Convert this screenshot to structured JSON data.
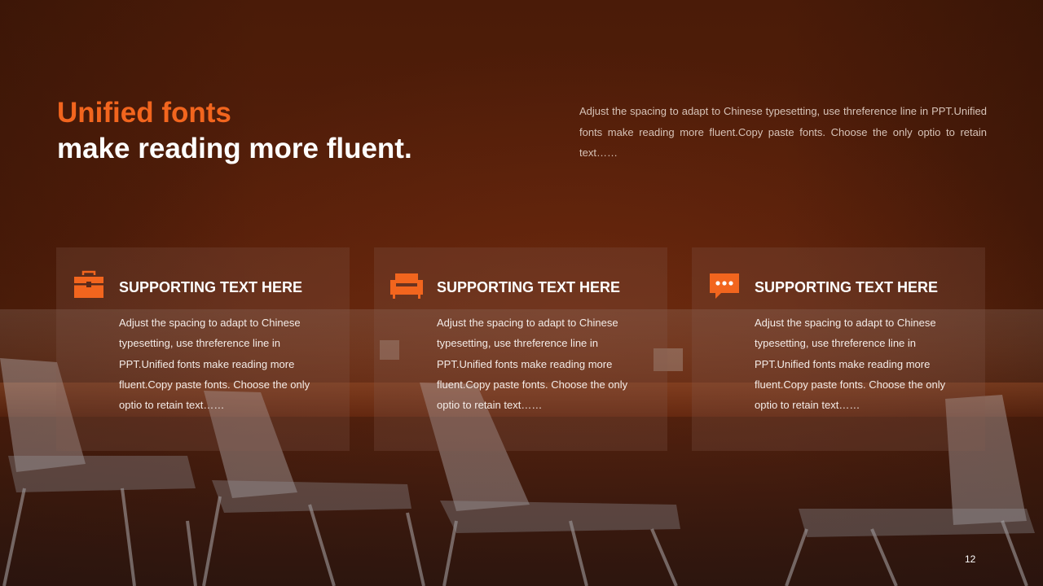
{
  "slide": {
    "title_accent": "Unified fonts",
    "title_main": "make reading more fluent.",
    "intro_text": "Adjust the spacing to adapt to Chinese typesetting, use threference line in PPT.Unified fonts make reading more fluent.Copy paste fonts. Choose the only optio to retain text……",
    "page_number": "12",
    "cards": [
      {
        "icon": "toolbox-icon",
        "title": "SUPPORTING TEXT HERE",
        "text": "Adjust the spacing to adapt to Chinese typesetting, use threference line in PPT.Unified fonts make reading more fluent.Copy paste fonts. Choose the only optio to retain text……"
      },
      {
        "icon": "sofa-icon",
        "title": "SUPPORTING TEXT HERE",
        "text": "Adjust the spacing to adapt to Chinese typesetting, use threference line in PPT.Unified fonts make reading more fluent.Copy paste fonts. Choose the only optio to retain text……"
      },
      {
        "icon": "chat-bubble-icon",
        "title": "SUPPORTING TEXT HERE",
        "text": "Adjust the spacing to adapt to Chinese typesetting, use threference line in PPT.Unified fonts make reading more fluent.Copy paste fonts. Choose the only optio to retain text……"
      }
    ]
  },
  "colors": {
    "accent": "#f2651e",
    "background": "#561f0a",
    "text_primary": "#ffffff",
    "text_muted": "#d7c3b8"
  }
}
